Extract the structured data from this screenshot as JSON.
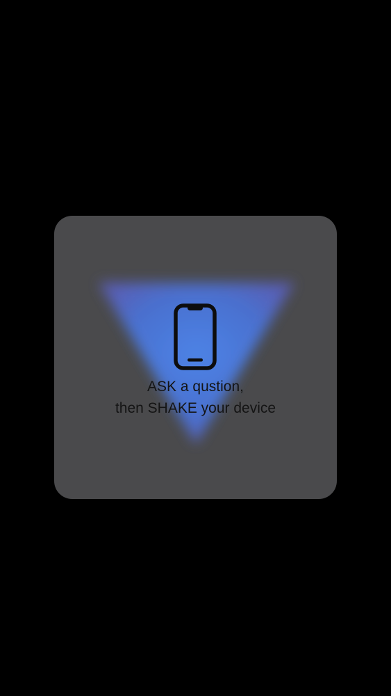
{
  "card": {
    "icon": "smartphone-icon",
    "line1": "ASK a qustion,",
    "line2": "then SHAKE your device"
  },
  "colors": {
    "background": "#000000",
    "card": "#4a4a4c",
    "glow": "#4d7fe6",
    "text": "#141414"
  }
}
